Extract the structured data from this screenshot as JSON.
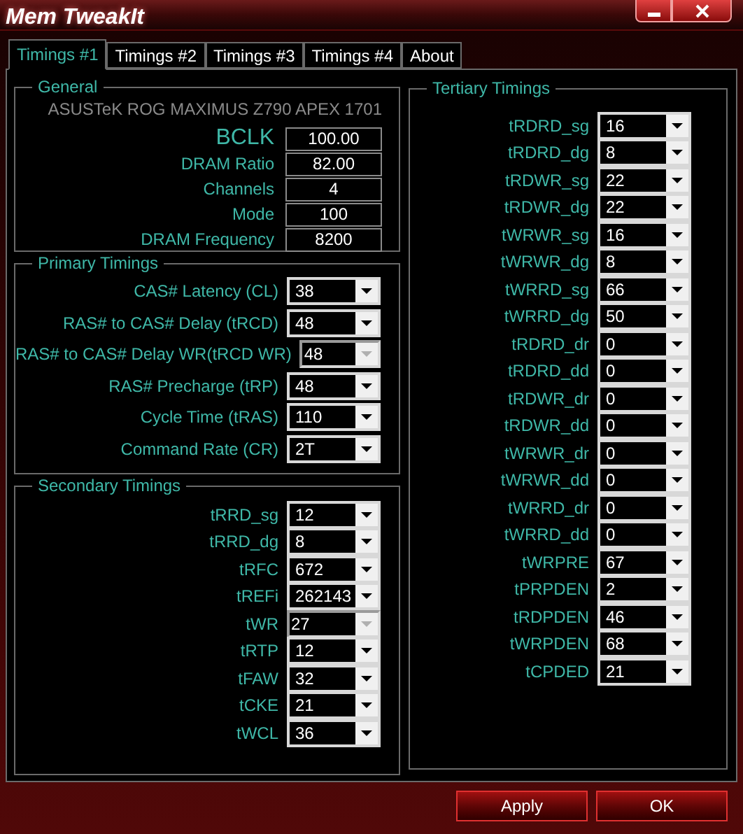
{
  "window": {
    "title": "Mem TweakIt"
  },
  "tabs": [
    {
      "label": "Timings #1",
      "selected": true
    },
    {
      "label": "Timings #2",
      "selected": false
    },
    {
      "label": "Timings #3",
      "selected": false
    },
    {
      "label": "Timings #4",
      "selected": false
    },
    {
      "label": "About",
      "selected": false
    }
  ],
  "general": {
    "title": "General",
    "board": "ASUSTeK ROG MAXIMUS Z790 APEX 1701",
    "fields": [
      {
        "label": "BCLK",
        "value": "100.00",
        "emphasized": true
      },
      {
        "label": "DRAM Ratio",
        "value": "82.00",
        "emphasized": false
      },
      {
        "label": "Channels",
        "value": "4",
        "emphasized": false
      },
      {
        "label": "Mode",
        "value": "100",
        "emphasized": false
      },
      {
        "label": "DRAM Frequency",
        "value": "8200",
        "emphasized": false
      }
    ]
  },
  "primary": {
    "title": "Primary Timings",
    "rows": [
      {
        "label": "CAS# Latency (CL)",
        "value": "38",
        "disabled": false
      },
      {
        "label": "RAS# to CAS# Delay (tRCD)",
        "value": "48",
        "disabled": false
      },
      {
        "label": "RAS# to CAS# Delay WR(tRCD WR)",
        "value": "48",
        "disabled": true
      },
      {
        "label": "RAS# Precharge (tRP)",
        "value": "48",
        "disabled": false
      },
      {
        "label": "Cycle Time (tRAS)",
        "value": "110",
        "disabled": false
      },
      {
        "label": "Command Rate (CR)",
        "value": "2T",
        "disabled": false
      }
    ]
  },
  "secondary": {
    "title": "Secondary Timings",
    "rows": [
      {
        "label": "tRRD_sg",
        "value": "12",
        "disabled": false
      },
      {
        "label": "tRRD_dg",
        "value": "8",
        "disabled": false
      },
      {
        "label": "tRFC",
        "value": "672",
        "disabled": false
      },
      {
        "label": "tREFi",
        "value": "262143",
        "disabled": false
      },
      {
        "label": "tWR",
        "value": "27",
        "disabled": true
      },
      {
        "label": "tRTP",
        "value": "12",
        "disabled": false
      },
      {
        "label": "tFAW",
        "value": "32",
        "disabled": false
      },
      {
        "label": "tCKE",
        "value": "21",
        "disabled": false
      },
      {
        "label": "tWCL",
        "value": "36",
        "disabled": false
      }
    ]
  },
  "tertiary": {
    "title": "Tertiary Timings",
    "rows": [
      {
        "label": "tRDRD_sg",
        "value": "16",
        "disabled": false
      },
      {
        "label": "tRDRD_dg",
        "value": "8",
        "disabled": false
      },
      {
        "label": "tRDWR_sg",
        "value": "22",
        "disabled": false
      },
      {
        "label": "tRDWR_dg",
        "value": "22",
        "disabled": false
      },
      {
        "label": "tWRWR_sg",
        "value": "16",
        "disabled": false
      },
      {
        "label": "tWRWR_dg",
        "value": "8",
        "disabled": false
      },
      {
        "label": "tWRRD_sg",
        "value": "66",
        "disabled": false
      },
      {
        "label": "tWRRD_dg",
        "value": "50",
        "disabled": false
      },
      {
        "label": "tRDRD_dr",
        "value": "0",
        "disabled": false
      },
      {
        "label": "tRDRD_dd",
        "value": "0",
        "disabled": false
      },
      {
        "label": "tRDWR_dr",
        "value": "0",
        "disabled": false
      },
      {
        "label": "tRDWR_dd",
        "value": "0",
        "disabled": false
      },
      {
        "label": "tWRWR_dr",
        "value": "0",
        "disabled": false
      },
      {
        "label": "tWRWR_dd",
        "value": "0",
        "disabled": false
      },
      {
        "label": "tWRRD_dr",
        "value": "0",
        "disabled": false
      },
      {
        "label": "tWRRD_dd",
        "value": "0",
        "disabled": false
      },
      {
        "label": "tWRPRE",
        "value": "67",
        "disabled": false
      },
      {
        "label": "tPRPDEN",
        "value": "2",
        "disabled": false
      },
      {
        "label": "tRDPDEN",
        "value": "46",
        "disabled": false
      },
      {
        "label": "tWRPDEN",
        "value": "68",
        "disabled": false
      },
      {
        "label": "tCPDED",
        "value": "21",
        "disabled": false
      }
    ]
  },
  "buttons": [
    {
      "label": "Apply"
    },
    {
      "label": "OK"
    }
  ]
}
